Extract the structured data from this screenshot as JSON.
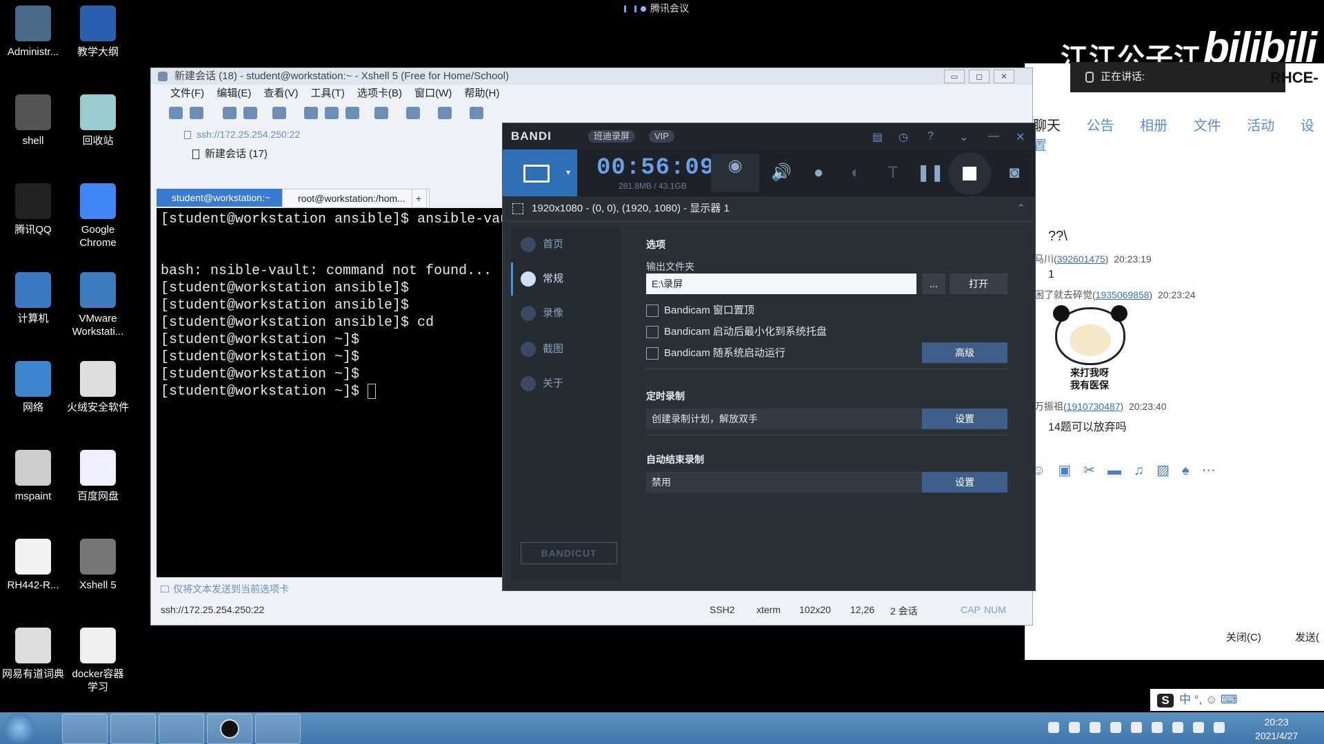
{
  "meeting": {
    "label": "腾讯会议"
  },
  "brand": {
    "name": "江江公子江",
    "bili": "bilibili"
  },
  "desktop_icons": [
    {
      "label": "Administr...",
      "icon": "user-folder-icon",
      "color": "#4a6a8a"
    },
    {
      "label": "教学大纲",
      "icon": "word-doc-icon",
      "color": "#2b5fb0"
    },
    {
      "label": "shell",
      "icon": "shell-cherry-icon",
      "color": "#555"
    },
    {
      "label": "回收站",
      "icon": "recycle-bin-icon",
      "color": "#9cc"
    },
    {
      "label": "腾讯QQ",
      "icon": "qq-penguin-icon",
      "color": "#222"
    },
    {
      "label": "Google\nChrome",
      "icon": "chrome-icon",
      "color": "#4285f4"
    },
    {
      "label": "计算机",
      "icon": "computer-icon",
      "color": "#3b7bc2"
    },
    {
      "label": "VMware\nWorkstati...",
      "icon": "vmware-icon",
      "color": "#3d7cbf"
    },
    {
      "label": "网络",
      "icon": "network-globe-icon",
      "color": "#3e86d0"
    },
    {
      "label": "火绒安全软件",
      "icon": "huorong-shield-icon",
      "color": "#ddd"
    },
    {
      "label": "mspaint",
      "icon": "mspaint-icon",
      "color": "#ccc"
    },
    {
      "label": "百度网盘",
      "icon": "baidu-netdisk-icon",
      "color": "#eef"
    },
    {
      "label": "RH442-R...",
      "icon": "pdf-icon",
      "color": "#f2f2f2"
    },
    {
      "label": "Xshell 5",
      "icon": "xshell-icon",
      "color": "#777"
    },
    {
      "label": "网易有道词典",
      "icon": "youdao-icon",
      "color": "#ddd"
    },
    {
      "label": "docker容器\n学习",
      "icon": "docker-doc-icon",
      "color": "#eee"
    }
  ],
  "qq": {
    "speaking": "正在讲话:",
    "group_title": "RHCE-",
    "tabs": [
      "聊天",
      "公告",
      "相册",
      "文件",
      "活动",
      "设置"
    ],
    "messages": [
      {
        "text": "??\\"
      },
      {
        "sender": "马川",
        "id": "392601475",
        "time": "20:23:19",
        "text": "1"
      },
      {
        "sender": "困了就去碎觉",
        "id": "1935069858",
        "time": "20:23:24",
        "sticker_caption": "来打我呀\n我有医保"
      },
      {
        "sender": "万振祖",
        "id": "1910730487",
        "time": "20:23:40",
        "text": "14题可以放弃吗"
      }
    ],
    "toolbar_icons": [
      "emoji-icon",
      "gif-icon",
      "scissors-icon",
      "folder-icon",
      "music-icon",
      "image-icon",
      "bell-icon",
      "more-icon"
    ],
    "close_label": "关闭(C)",
    "send_label": "发送("
  },
  "xshell": {
    "title": "新建会话 (18) - student@workstation:~ - Xshell 5 (Free for Home/School)",
    "menu": [
      "文件(F)",
      "编辑(E)",
      "查看(V)",
      "工具(T)",
      "选项卡(B)",
      "窗口(W)",
      "帮助(H)"
    ],
    "address": "ssh://172.25.254.250:22",
    "session_link": "新建会话 (17)",
    "tabs": [
      {
        "label": "student@workstation:~",
        "active": true
      },
      {
        "label": "root@workstation:/hom...",
        "active": false
      }
    ],
    "add_tab": "+",
    "terminal_lines": [
      "[student@workstation ansible]$ ansible-vau",
      "",
      "",
      "bash: nsible-vault: command not found...",
      "[student@workstation ansible]$",
      "[student@workstation ansible]$",
      "[student@workstation ansible]$ cd",
      "[student@workstation ~]$",
      "[student@workstation ~]$",
      "[student@workstation ~]$",
      "[student@workstation ~]$ "
    ],
    "send_bar": "仅将文本发送到当前选项卡",
    "status": {
      "conn": "ssh://172.25.254.250:22",
      "proto": "SSH2",
      "term": "xterm",
      "size": "102x20",
      "pos": "12,26",
      "sessions": "2 会话",
      "cap": "CAP",
      "num": "NUM"
    }
  },
  "bandicam": {
    "logo": "BANDI",
    "pill1": "班迪录屏",
    "pill2": "VIP",
    "timer": "00:56:09",
    "size": "281.8MB / 43.1GB",
    "area": "1920x1080 - (0, 0), (1920, 1080) - 显示器 1",
    "side": [
      {
        "label": "首页",
        "active": false
      },
      {
        "label": "常规",
        "active": true
      },
      {
        "label": "录像",
        "active": false
      },
      {
        "label": "截图",
        "active": false
      },
      {
        "label": "关于",
        "active": false
      }
    ],
    "bandicut": "BANDICUT",
    "options_title": "选项",
    "output_label": "输出文件夹",
    "output_value": "E:\\录屏",
    "dots_btn": "...",
    "open_btn": "打开",
    "checks": [
      "Bandicam 窗口置顶",
      "Bandicam 启动后最小化到系统托盘",
      "Bandicam 随系统启动运行"
    ],
    "advanced_btn": "高级",
    "schedule_title": "定时录制",
    "schedule_text": "创建录制计划，解放双手",
    "schedule_btn": "设置",
    "autostop_title": "自动结束录制",
    "autostop_text": "禁用",
    "autostop_btn": "设置"
  },
  "ime": {
    "label": "中 °, ☺ ⌨"
  },
  "clock": {
    "time": "20:23",
    "date": "2021/4/27"
  }
}
